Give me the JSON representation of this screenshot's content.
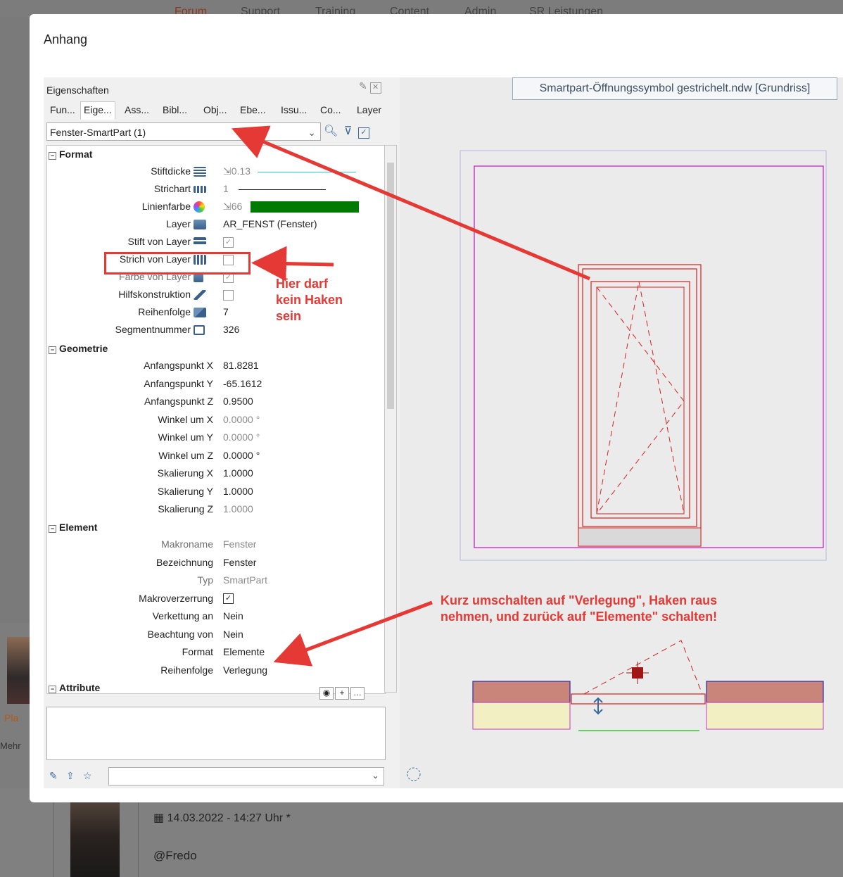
{
  "nav": [
    "Forum",
    "Support",
    "Training",
    "Content",
    "Admin",
    "SR Leistungen"
  ],
  "dialog": {
    "title": "Anhang"
  },
  "panel": {
    "title": "Eigenschaften",
    "tabs": [
      "Fun...",
      "Eige...",
      "Ass...",
      "Bibl...",
      "Obj...",
      "Ebe...",
      "Issu...",
      "Co...",
      "Layer"
    ],
    "selected_tab": "Eige...",
    "selector": "Fenster-SmartPart (1)",
    "sections": {
      "format": "Format",
      "geometrie": "Geometrie",
      "element": "Element",
      "attribute": "Attribute"
    },
    "format": {
      "stiftdicke": {
        "label": "Stiftdicke",
        "value": "0.13"
      },
      "strichart": {
        "label": "Strichart",
        "value": "1"
      },
      "linienfarbe": {
        "label": "Linienfarbe",
        "value": "66",
        "color": "#007a00"
      },
      "layer": {
        "label": "Layer",
        "value": "AR_FENST (Fenster)"
      },
      "stift_von_layer": {
        "label": "Stift von Layer",
        "checked": true
      },
      "strich_von_layer": {
        "label": "Strich von Layer",
        "checked": false
      },
      "farbe_von_layer": {
        "label": "Farbe von Layer",
        "checked": true
      },
      "hilfskonstruktion": {
        "label": "Hilfskonstruktion",
        "checked": false
      },
      "reihenfolge": {
        "label": "Reihenfolge",
        "value": "7"
      },
      "segmentnummer": {
        "label": "Segmentnummer",
        "value": "326"
      }
    },
    "geometrie": [
      {
        "label": "Anfangspunkt X",
        "value": "81.8281",
        "gray": false
      },
      {
        "label": "Anfangspunkt Y",
        "value": "-65.1612",
        "gray": false
      },
      {
        "label": "Anfangspunkt Z",
        "value": "0.9500",
        "gray": false
      },
      {
        "label": "Winkel um X",
        "value": "0.0000 °",
        "gray": true
      },
      {
        "label": "Winkel um Y",
        "value": "0.0000 °",
        "gray": true
      },
      {
        "label": "Winkel um Z",
        "value": "0.0000 °",
        "gray": false
      },
      {
        "label": "Skalierung X",
        "value": "1.0000",
        "gray": false
      },
      {
        "label": "Skalierung Y",
        "value": "1.0000",
        "gray": false
      },
      {
        "label": "Skalierung Z",
        "value": "1.0000",
        "gray": true
      }
    ],
    "element": [
      {
        "label": "Makroname",
        "value": "Fenster",
        "gray": true
      },
      {
        "label": "Bezeichnung",
        "value": "Fenster",
        "gray": false
      },
      {
        "label": "Typ",
        "value": "SmartPart",
        "gray": true
      },
      {
        "label": "Makroverzerrung",
        "value": "",
        "gray": false,
        "checkbox": true
      },
      {
        "label": "Verkettung an",
        "value": "Nein",
        "gray": false
      },
      {
        "label": "Beachtung von",
        "value": "Nein",
        "gray": false
      },
      {
        "label": "Format",
        "value": "Elemente",
        "gray": false
      },
      {
        "label": "Reihenfolge",
        "value": "Verlegung",
        "gray": false
      }
    ]
  },
  "canvas": {
    "title": "Smartpart-Öffnungssymbol gestrichelt.ndw [Grundriss]"
  },
  "callouts": {
    "hint1": [
      "Hier darf",
      "kein Haken",
      "sein"
    ],
    "hint2": [
      "Kurz umschalten auf \"Verlegung\", Haken raus",
      "nehmen, und zurück auf \"Elemente\" schalten!"
    ]
  },
  "post": {
    "date": "14.03.2022 - 14:27 Uhr *",
    "mention": "@Fredo"
  },
  "side": {
    "pla": "Pla",
    "mehr": "Mehr"
  }
}
